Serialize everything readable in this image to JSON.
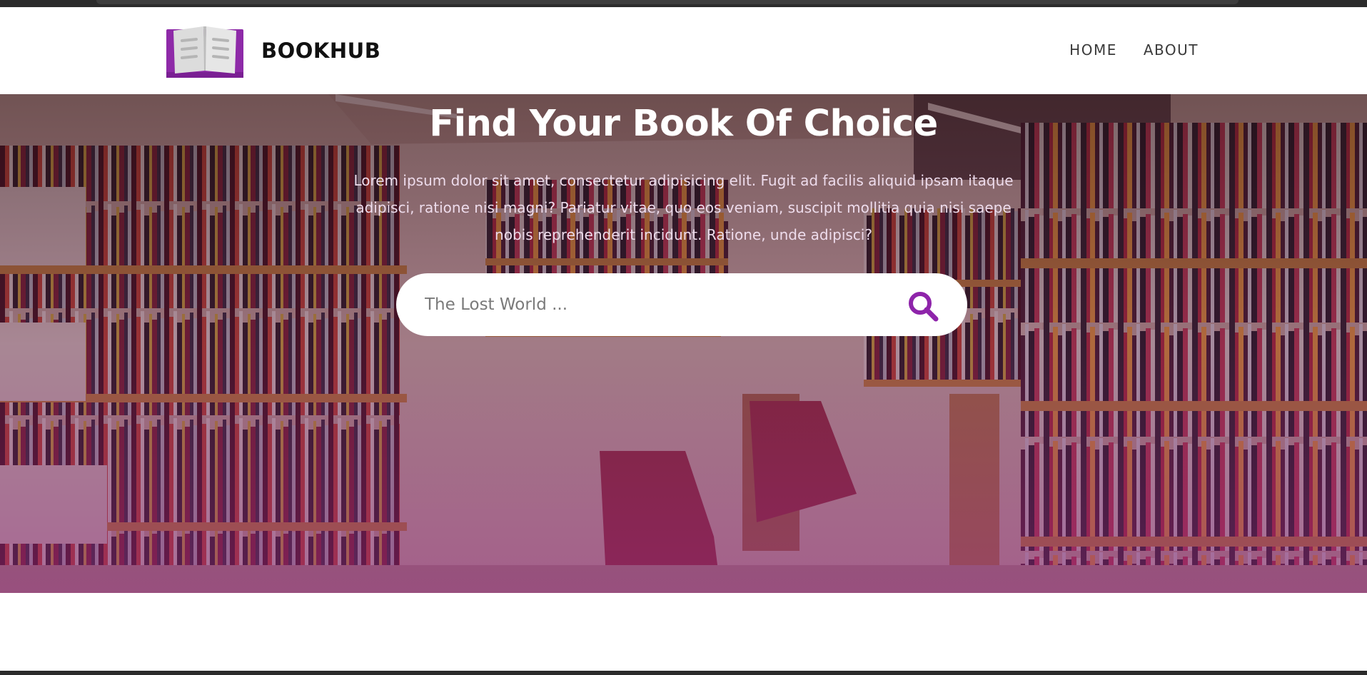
{
  "brand": {
    "name": "BOOKHUB",
    "logo_icon": "open-book-icon",
    "accent": "#9b2fc0"
  },
  "nav": {
    "items": [
      {
        "label": "HOME"
      },
      {
        "label": "ABOUT"
      }
    ]
  },
  "hero": {
    "title": "Find Your Book Of Choice",
    "text": "Lorem ipsum dolor sit amet, consectetur adipisicing elit. Fugit ad facilis aliquid ipsam itaque adipisci, ratione nisi magni? Pariatur vitae, quo eos veniam, suscipit mollitia quia nisi saepe nobis reprehenderit incidunt. Ratione, unde adipisci?",
    "background": "library-bookshelves-photo"
  },
  "search": {
    "placeholder": "The Lost World ...",
    "value": "",
    "icon": "search-icon",
    "icon_color": "#8e24aa"
  }
}
